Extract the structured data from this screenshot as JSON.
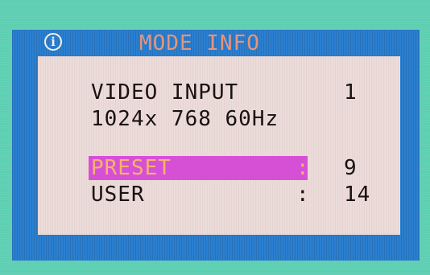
{
  "osd": {
    "icon": "info-icon",
    "title": "MODE INFO",
    "video_input_label": "VIDEO INPUT",
    "video_input_value": "1",
    "resolution": "1024x 768 60Hz",
    "preset_label": "PRESET",
    "preset_sep": ":",
    "preset_value": "9",
    "user_label": "USER",
    "user_sep": ":",
    "user_value": "14"
  },
  "colors": {
    "background": "#5ecfb2",
    "frame": "#2b7fd0",
    "content": "#ecdcd9",
    "title_text": "#e6957b",
    "highlight": "#d650d6",
    "highlight_text": "#f6b36a",
    "text": "#1a1210"
  }
}
